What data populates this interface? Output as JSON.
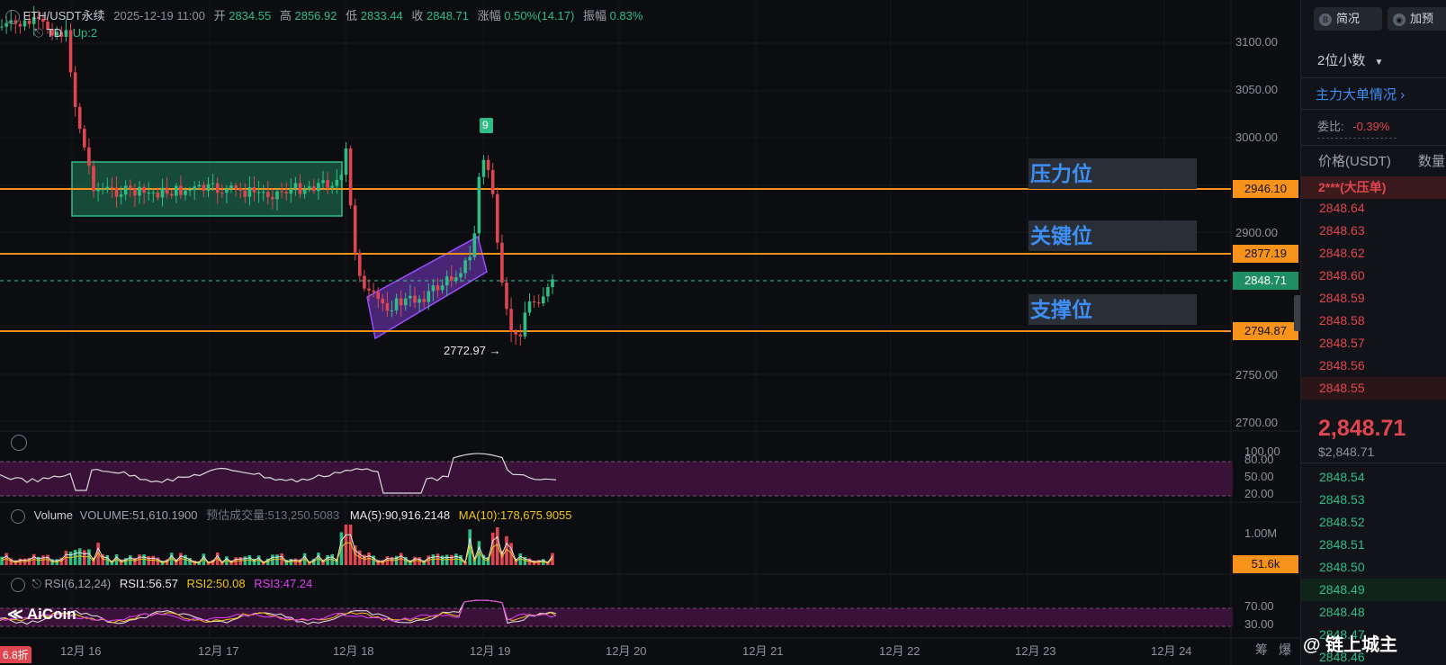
{
  "header": {
    "symbol": "ETH/USDT永续",
    "datetime": "2025-12-19 11:00",
    "open_label": "开",
    "open": "2834.55",
    "high_label": "高",
    "high": "2856.92",
    "low_label": "低",
    "low": "2833.44",
    "close_label": "收",
    "close": "2848.71",
    "change_label": "涨幅",
    "change": "0.50%(14.17)",
    "amp_label": "振幅",
    "amp": "0.83%",
    "indicator": "TD",
    "indicator_value": "Up:2"
  },
  "price_axis": [
    "3100.00",
    "3050.00",
    "3000.00",
    "2900.00",
    "2750.00",
    "2700.00"
  ],
  "levels": {
    "resistance": {
      "label": "压力位",
      "price": "2946.10"
    },
    "key": {
      "label": "关键位",
      "price": "2877.19"
    },
    "current": {
      "price": "2848.71"
    },
    "support": {
      "label": "支撑位",
      "price": "2794.87"
    }
  },
  "annotations": {
    "low_marker": "2772.97 →",
    "td_count": "9"
  },
  "sub_axis": {
    "osc": [
      "100.00",
      "80.00",
      "50.00",
      "20.00"
    ],
    "volume": [
      "1.00M"
    ],
    "volume_tag": "51.6k",
    "rsi": [
      "70.00",
      "30.00"
    ]
  },
  "volume_header": {
    "name": "Volume",
    "value": "VOLUME:51,610.1900",
    "estimate": "预估成交量:513,250.5083",
    "ma5": "MA(5):90,916.2148",
    "ma10": "MA(10):178,675.9055"
  },
  "rsi_header": {
    "name": "RSI(6,12,24)",
    "rsi1": "RSI1:56.57",
    "rsi2": "RSI2:50.08",
    "rsi3": "RSI3:47.24"
  },
  "x_axis": [
    "12月 16",
    "12月 17",
    "12月 18",
    "12月 19",
    "12月 20",
    "12月 21",
    "12月 22",
    "12月 23",
    "12月 24"
  ],
  "x_axis_right": {
    "a": "筹",
    "b": "爆"
  },
  "logo": "AiCoin",
  "discount_badge": "6.8折",
  "watermark": "@ 链上城主",
  "sidebar": {
    "btn_brief": "简况",
    "btn_add": "加预",
    "decimals": "2位小数",
    "big_orders": "主力大单情况",
    "ratio_label": "委比:",
    "ratio_value": "-0.39%",
    "col_price": "价格(USDT)",
    "col_qty": "数量",
    "big_ask": "2***(大压单)",
    "asks": [
      "2848.64",
      "2848.63",
      "2848.62",
      "2848.60",
      "2848.59",
      "2848.58",
      "2848.57",
      "2848.56",
      "2848.55"
    ],
    "last_price": "2,848.71",
    "last_usd": "$2,848.71",
    "bids": [
      "2848.54",
      "2848.53",
      "2848.52",
      "2848.51",
      "2848.50",
      "2848.49",
      "2848.48",
      "2848.47",
      "2848.46"
    ]
  },
  "colors": {
    "up": "#2ebd85",
    "down": "#e0464f",
    "level_line": "#f7931a",
    "zone_label": "#3d8ff5",
    "ma5": "#e6e6e6",
    "ma10": "#f0c419"
  }
}
